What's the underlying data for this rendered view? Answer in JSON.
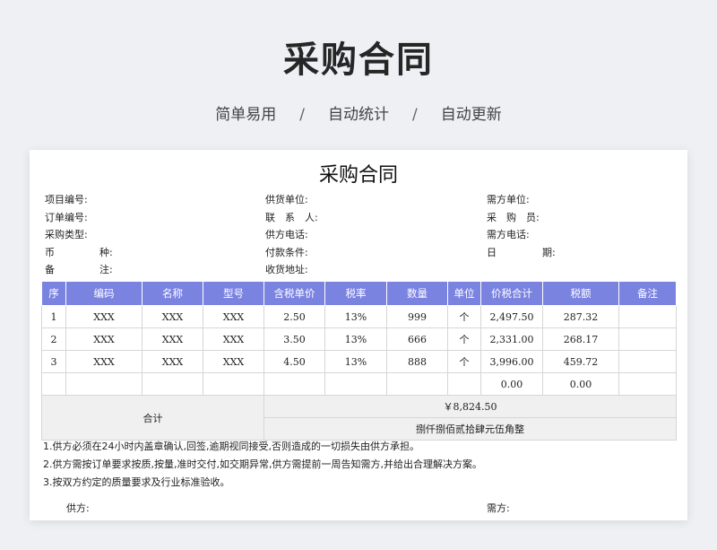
{
  "header": {
    "title": "采购合同",
    "tags": [
      "简单易用",
      "自动统计",
      "自动更新"
    ],
    "separator": "/"
  },
  "doc": {
    "title": "采购合同",
    "info": {
      "project_no": "项目编号:",
      "supplier": "供货单位:",
      "buyer": "需方单位:",
      "order_no": "订单编号:",
      "contact": "联　系　人:",
      "purchaser": "采　购　员:",
      "purchase_type": "采购类型:",
      "supplier_phone": "供方电话:",
      "buyer_phone": "需方电话:",
      "currency_a": "币",
      "currency_b": "种:",
      "payment": "付款条件:",
      "date_a": "日",
      "date_b": "期:",
      "remark_a": "备",
      "remark_b": "注:",
      "address": "收货地址:"
    },
    "columns": [
      "序",
      "编码",
      "名称",
      "型号",
      "含税单价",
      "税率",
      "数量",
      "单位",
      "价税合计",
      "税额",
      "备注"
    ],
    "rows": [
      [
        "1",
        "XXX",
        "XXX",
        "XXX",
        "2.50",
        "13%",
        "999",
        "个",
        "2,497.50",
        "287.32",
        ""
      ],
      [
        "2",
        "XXX",
        "XXX",
        "XXX",
        "3.50",
        "13%",
        "666",
        "个",
        "2,331.00",
        "268.17",
        ""
      ],
      [
        "3",
        "XXX",
        "XXX",
        "XXX",
        "4.50",
        "13%",
        "888",
        "个",
        "3,996.00",
        "459.72",
        ""
      ],
      [
        "",
        "",
        "",
        "",
        "",
        "",
        "",
        "",
        "0.00",
        "0.00",
        ""
      ]
    ],
    "total": {
      "label": "合计",
      "amount": "￥8,824.50",
      "amount_words": "捌仟捌佰贰拾肆元伍角整"
    },
    "terms": [
      "1.供方必须在24小时内盖章确认,回签,逾期视同接受,否则造成的一切损失由供方承担。",
      "2.供方需按订单要求按质,按量,准时交付,如交期异常,供方需提前一周告知需方,并给出合理解决方案。",
      "3.按双方约定的质量要求及行业标准验收。"
    ],
    "sign": {
      "supplier": "供方:",
      "buyer": "需方:"
    }
  },
  "colors": {
    "header_bg": "#7b83e0",
    "page_bg": "#eef0f4"
  }
}
